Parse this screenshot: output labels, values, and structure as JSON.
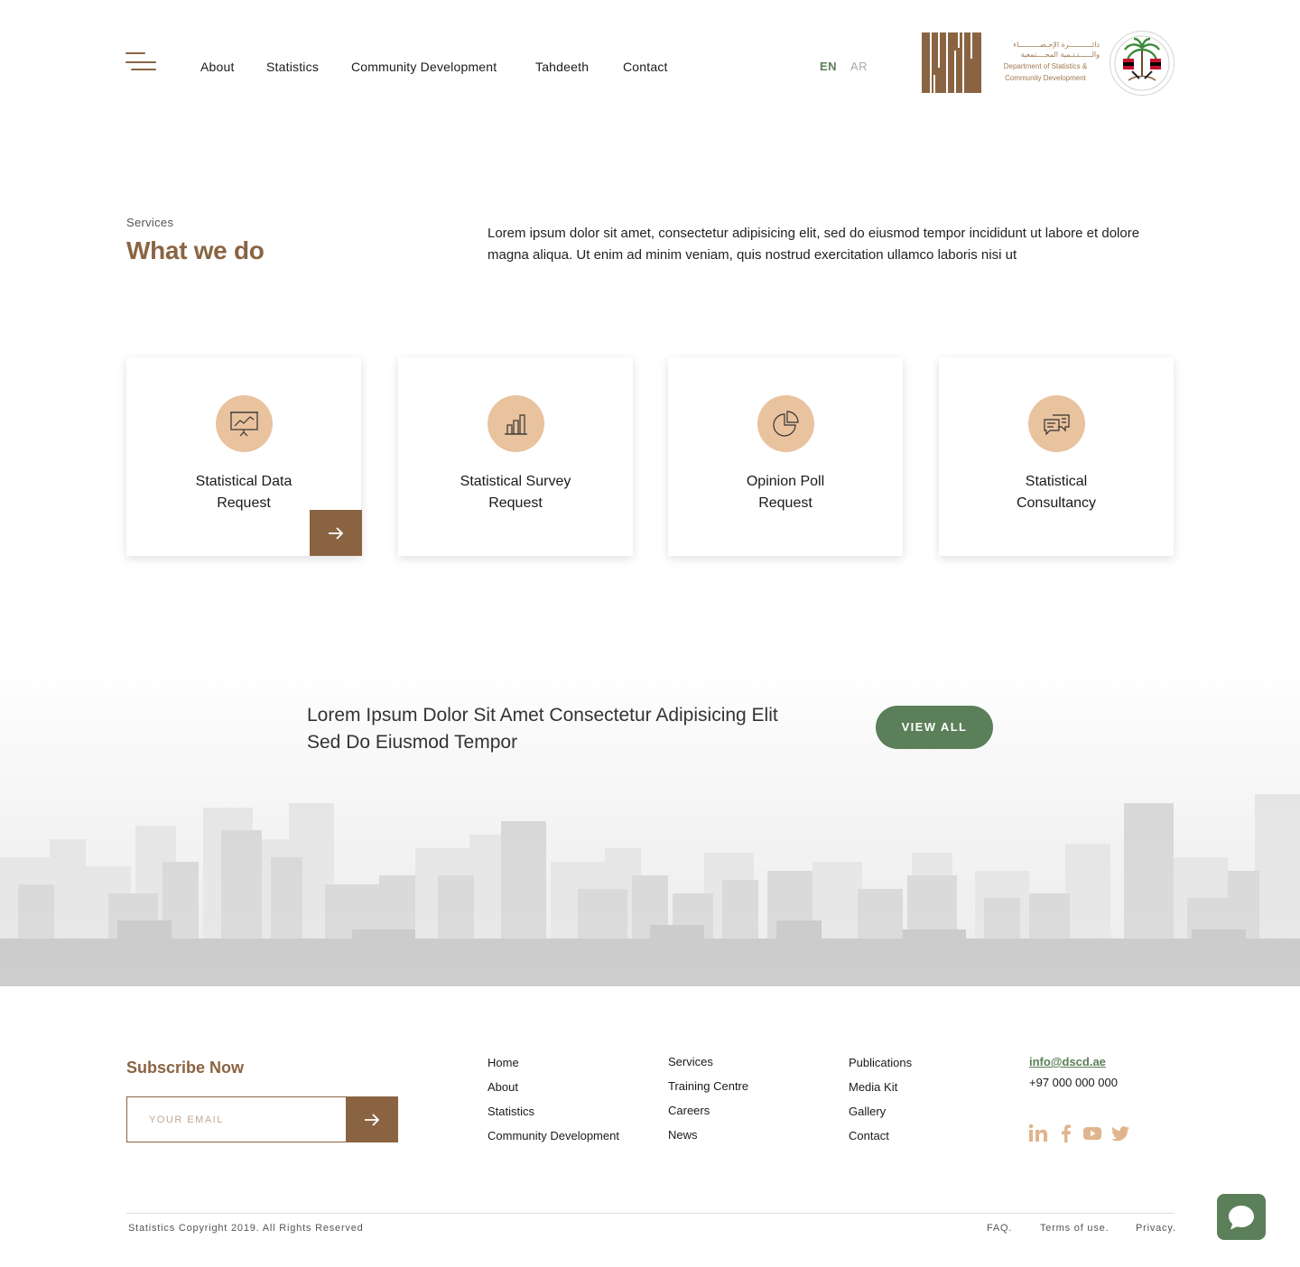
{
  "header": {
    "nav": [
      {
        "label": "About"
      },
      {
        "label": "Statistics"
      },
      {
        "label": "Community Development"
      },
      {
        "label": "Tahdeeth"
      },
      {
        "label": "Contact"
      }
    ],
    "lang_en": "EN",
    "lang_ar": "AR",
    "logo_text_ar_1": "دائـــــــــــرة الإحـصــــــــــاء",
    "logo_text_ar_2": "والــــــتـنـمية المجــــتمعية",
    "logo_text_en_1": "Department of Statistics &",
    "logo_text_en_2": "Community Development"
  },
  "services": {
    "eyebrow": "Services",
    "title": "What we do",
    "intro": "Lorem ipsum dolor sit amet, consectetur adipisicing elit, sed do eiusmod tempor incididunt ut labore et dolore magna aliqua. Ut enim ad minim veniam, quis nostrud exercitation ullamco laboris nisi ut",
    "cards": [
      {
        "line1": "Statistical Data",
        "line2": "Request",
        "icon": "presentation-chart-icon"
      },
      {
        "line1": "Statistical Survey",
        "line2": "Request",
        "icon": "bar-chart-icon"
      },
      {
        "line1": "Opinion Poll",
        "line2": "Request",
        "icon": "pie-chart-icon"
      },
      {
        "line1": "Statistical",
        "line2": "Consultancy",
        "icon": "chat-bubbles-icon"
      }
    ]
  },
  "banner": {
    "text_line1": "Lorem Ipsum Dolor Sit Amet Consectetur Adipisicing Elit",
    "text_line2": "Sed Do Eiusmod Tempor",
    "button": "VIEW ALL"
  },
  "footer": {
    "subscribe_title": "Subscribe Now",
    "email_placeholder": "YOUR EMAIL",
    "col1": [
      "Home",
      "About",
      "Statistics",
      "Community Development"
    ],
    "col2": [
      "Services",
      "Training Centre",
      "Careers",
      "News"
    ],
    "col3": [
      "Publications",
      "Media Kit",
      "Gallery",
      "Contact"
    ],
    "contact_email": "info@dscd.ae",
    "contact_phone": "+97 000 000 000",
    "social": [
      "linkedin-icon",
      "facebook-icon",
      "youtube-icon",
      "twitter-icon"
    ],
    "copyright": "Statistics Copyright 2019. All Rights Reserved",
    "legal": [
      "FAQ.",
      "Terms of use.",
      "Privacy."
    ]
  },
  "colors": {
    "brown": "#8a6442",
    "green": "#5b7f58",
    "peach": "#e9c29e"
  }
}
